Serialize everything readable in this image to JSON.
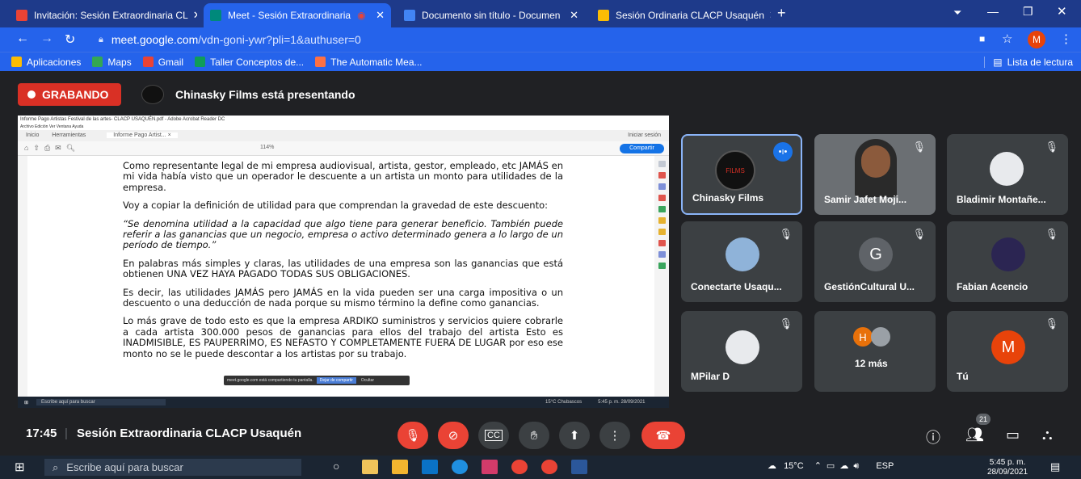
{
  "browser": {
    "tabs": [
      {
        "label": "Invitación: Sesión Extraordinaria CL",
        "icon": "gmail-icon",
        "color": "#ea4335"
      },
      {
        "label": "Meet - Sesión Extraordinaria",
        "icon": "meet-icon",
        "color": "#00897b",
        "active": true
      },
      {
        "label": "Documento sin título - Documen",
        "icon": "docs-icon",
        "color": "#4285f4"
      },
      {
        "label": "Sesión Ordinaria CLACP Usaquén",
        "icon": "drive-icon",
        "color": "#fbbc04"
      }
    ],
    "new_tab": "+",
    "url_host": "meet.google.com",
    "url_path": "/vdn-goni-ywr?pli=1&authuser=0",
    "profile_initial": "M",
    "bookmarks": [
      "Aplicaciones",
      "Maps",
      "Gmail",
      "Taller Conceptos de...",
      "The Automatic Mea..."
    ],
    "reading_list": "Lista de lectura"
  },
  "meet": {
    "recording_label": "GRABANDO",
    "presenter_label": "Chinasky Films está presentando",
    "time": "17:45",
    "separator": "|",
    "meeting_title": "Sesión Extraordinaria CLACP Usaquén",
    "participants_count": "21",
    "tiles": [
      {
        "name": "Chinasky Films",
        "active": true
      },
      {
        "name": "Samir Jafet Moji..."
      },
      {
        "name": "Bladimir Montañe..."
      },
      {
        "name": "Conectarte Usaqu..."
      },
      {
        "name": "GestiónCultural U...",
        "initial": "G",
        "color": "#5f6368"
      },
      {
        "name": "Fabian Acencio"
      },
      {
        "name": "MPilar D"
      },
      {
        "name": "12 más",
        "initial": "H",
        "color": "#e8710a"
      },
      {
        "name": "Tú",
        "initial": "M",
        "color": "#e8430a"
      }
    ]
  },
  "shared": {
    "window_title": "Informe Pago Artistas Festival de las artes- CLACP USAQUÉN.pdf - Adobe Acrobat Reader DC",
    "menu": "Archivo  Edición  Ver  Ventana  Ayuda",
    "tabs": [
      "Inicio",
      "Herramientas",
      "Informe Pago Artist... ×"
    ],
    "sign_in": "Iniciar sesión",
    "share_btn": "Compartir",
    "zoom": "114%",
    "paragraphs": [
      "Como representante legal de mi empresa audiovisual, artista, gestor, empleado, etc JAMÁS en mi vida había visto que un operador le descuente a un artista un monto para utilidades de la empresa.",
      "Voy a copiar la definición de utilidad para que comprendan la gravedad de este descuento:",
      "“Se denomina utilidad a la capacidad que algo tiene para generar beneficio. También puede referir a las ganancias que un negocio, empresa o activo determinado genera a lo largo de un período de tiempo.”",
      "En palabras más simples y claras, las utilidades de una empresa son las ganancias que está obtienen UNA VEZ HAYA PAGADO TODAS SUS OBLIGACIONES.",
      "Es decir, las utilidades JAMÁS pero JAMÁS en la vida pueden ser una carga impositiva o un descuento o una deducción de nada porque su mismo término la define como ganancias.",
      "Lo más grave de todo esto es que la empresa ARDIKO suministros y servicios quiere cobrarle a cada artista 300.000 pesos de ganancias para ellos del trabajo del artista Esto es INADMISIBLE, ES PAUPERRIMO, ES NEFASTO Y COMPLETAMENTE FUERA DE LUGAR por eso ese monto no se le puede descontar a los artistas por su trabajo."
    ],
    "share_notice": "meet.google.com está compartiendo tu pantalla.",
    "share_stop": "Dejar de compartir",
    "share_hide": "Ocultar",
    "inner_search": "Escribe aquí para buscar",
    "inner_tray": "15°C Chubascos",
    "inner_clock": "5:45 p. m.  28/09/2021"
  },
  "taskbar": {
    "search_placeholder": "Escribe aquí para buscar",
    "weather": "15°C",
    "lang": "ESP",
    "time": "5:45 p. m.",
    "date": "28/09/2021"
  }
}
